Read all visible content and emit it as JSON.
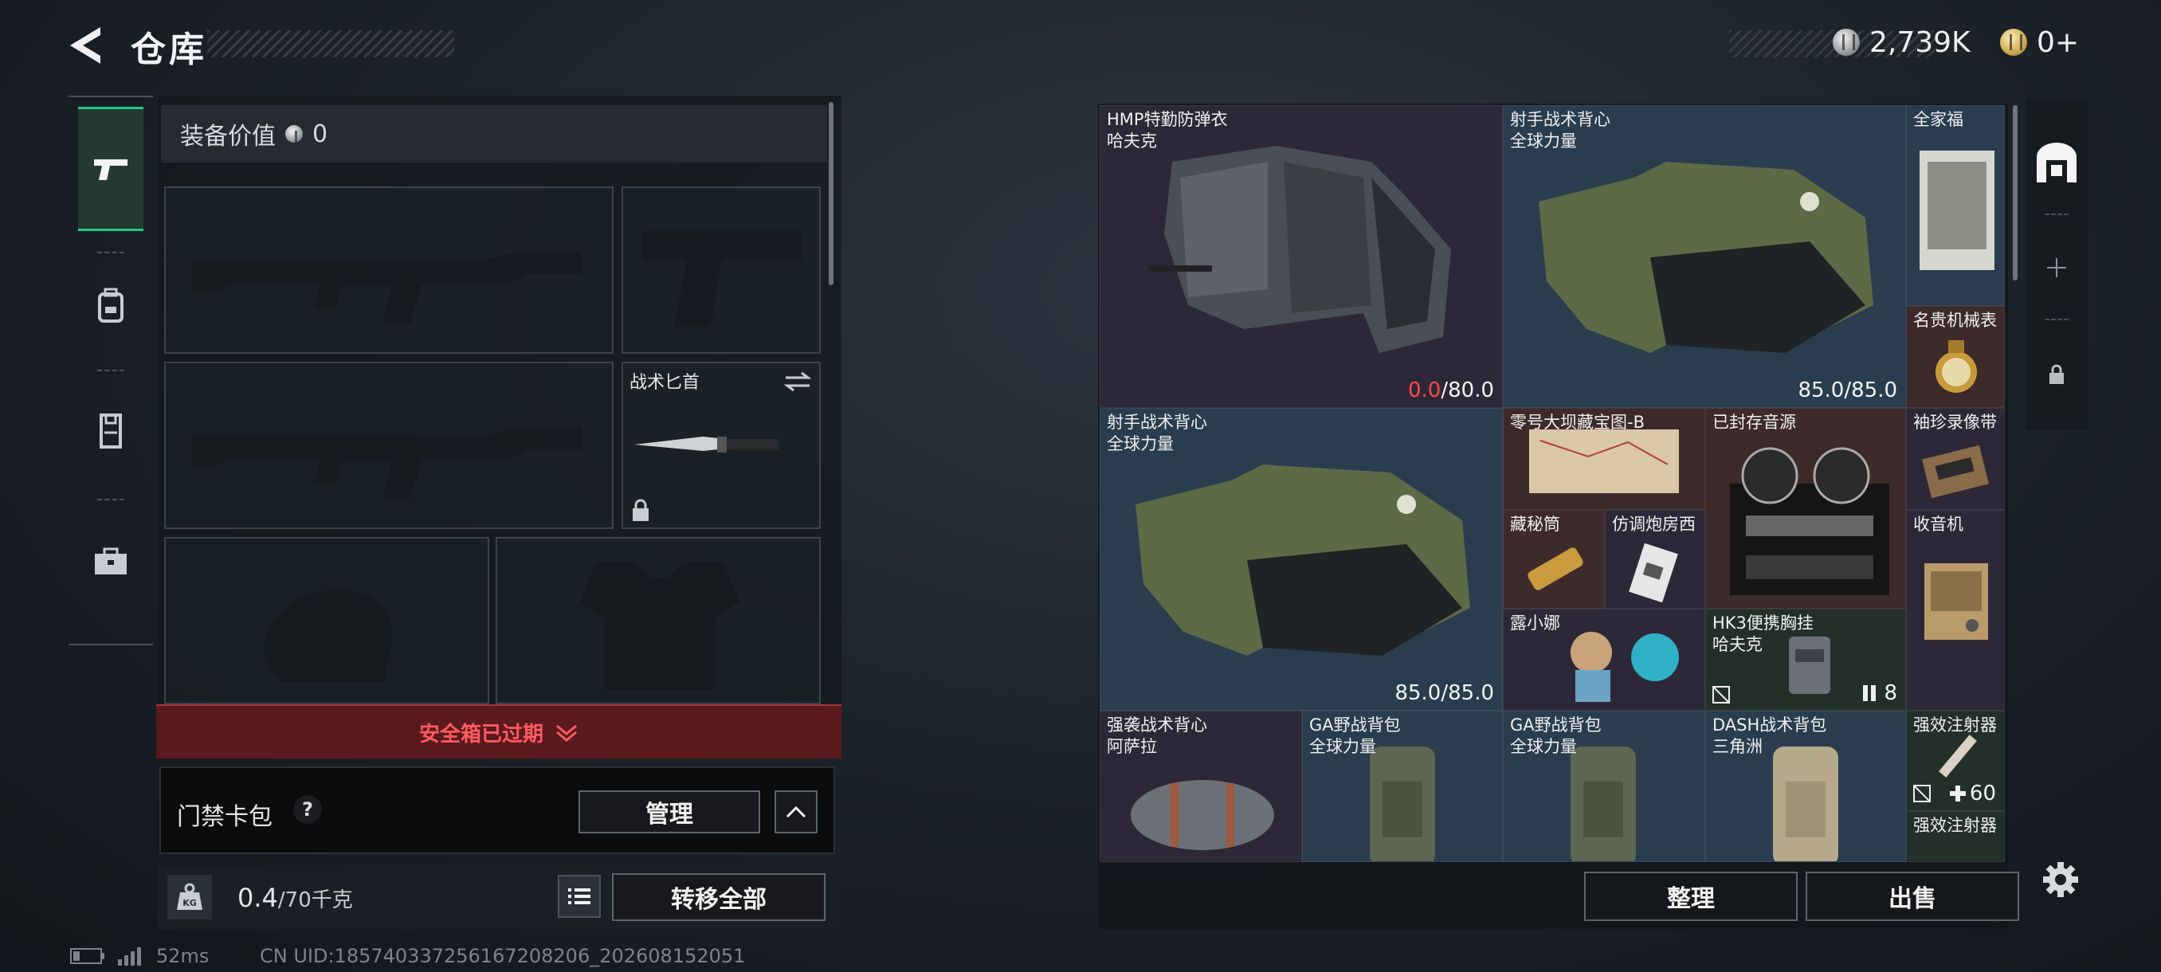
{
  "header": {
    "title": "仓库",
    "back_icon": "back-arrow-icon",
    "currencies": [
      {
        "icon": "silver-coin-icon",
        "value": "2,739K"
      },
      {
        "icon": "gold-coin-icon",
        "value": "0+"
      }
    ]
  },
  "left_nav": {
    "items": [
      {
        "name": "weapons",
        "icon": "pistol-icon",
        "active": true
      },
      {
        "name": "gear",
        "icon": "backpack-icon",
        "active": false
      },
      {
        "name": "armor",
        "icon": "vest-icon",
        "active": false
      },
      {
        "name": "cases",
        "icon": "briefcase-icon",
        "active": false
      }
    ]
  },
  "loadout": {
    "equip_value_label": "装备价值",
    "equip_value": "0",
    "knife_label": "战术匕首",
    "safe_box_status": "安全箱已过期",
    "keycard_label": "门禁卡包",
    "help": "?",
    "manage_label": "管理",
    "weight_current": "0.4",
    "weight_capacity": "/70千克",
    "weight_icon_text": "KG",
    "transfer_all_label": "转移全部"
  },
  "status": {
    "ping": "52ms",
    "uid": "CN UID:18574033725616​7208206_202608152051"
  },
  "storage": {
    "items": [
      {
        "name": "HMP特勤防弹衣",
        "sub": "哈夫克",
        "value_low": "0.0",
        "value_max": "/80.0",
        "color": "purple"
      },
      {
        "name": "射手战术背心",
        "sub": "全球力量",
        "value": "85.0/85.0",
        "color": "slate"
      },
      {
        "name": "全家福",
        "sub": "",
        "color": "slate"
      },
      {
        "name": "名贵机械表",
        "sub": "",
        "color": "brown"
      },
      {
        "name": "射手战术背心",
        "sub": "全球力量",
        "value": "85.0/85.0",
        "color": "slate"
      },
      {
        "name": "零号大坝藏宝图-B",
        "sub": "",
        "color": "brown"
      },
      {
        "name": "已封存音源",
        "sub": "",
        "color": "brown"
      },
      {
        "name": "袖珍录像带",
        "sub": "",
        "color": "purple"
      },
      {
        "name": "藏秘筒",
        "sub": "",
        "color": "brown"
      },
      {
        "name": "仿调炮房西",
        "sub": "",
        "color": "purple"
      },
      {
        "name": "收音机",
        "sub": "",
        "color": "purple"
      },
      {
        "name": "露小娜",
        "sub": "",
        "color": "purple"
      },
      {
        "name": "HK3便携胸挂",
        "sub": "哈夫克",
        "count": "8",
        "color": "green"
      },
      {
        "name": "强袭战术背心",
        "sub": "阿萨拉",
        "color": "purple"
      },
      {
        "name": "GA野战背包",
        "sub": "全球力量",
        "color": "slate"
      },
      {
        "name": "GA野战背包",
        "sub": "全球力量",
        "color": "slate"
      },
      {
        "name": "DASH战术背包",
        "sub": "三角洲",
        "color": "slate"
      },
      {
        "name": "强效注射器",
        "sub": "",
        "count": "60",
        "color": "green"
      },
      {
        "name": "强效注射器",
        "sub": "",
        "color": "green"
      }
    ],
    "sort_label": "整理",
    "sell_label": "出售"
  },
  "quick": {
    "icons": [
      "storage-vault-icon",
      "plus-icon",
      "lock-icon"
    ]
  }
}
